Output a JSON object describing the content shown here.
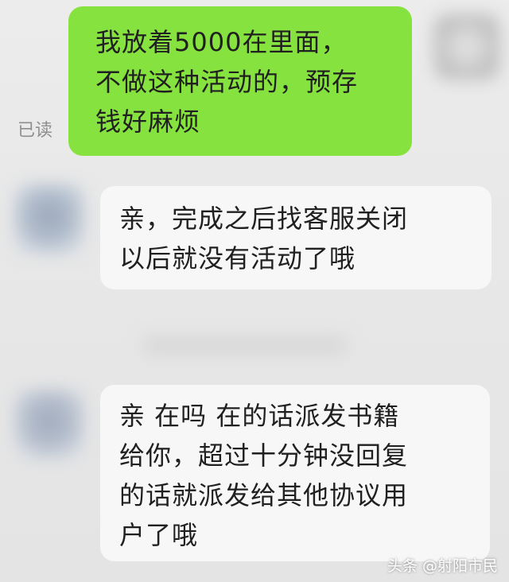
{
  "chat": {
    "sent_message": "我放着5000在里面，\n不做这种活动的，预存\n钱好麻烦",
    "read_status": "已读",
    "received_messages": [
      "亲，完成之后找客服关闭\n以后就没有活动了哦",
      "亲  在吗    在的话派发书籍\n给你，超过十分钟没回复\n的话就派发给其他协议用\n户了哦"
    ]
  },
  "watermark": "头条 @射阳市民",
  "colors": {
    "sent_bubble": "#86e23f",
    "received_bubble": "#f7f7f7",
    "background": "#e7e7e7"
  }
}
